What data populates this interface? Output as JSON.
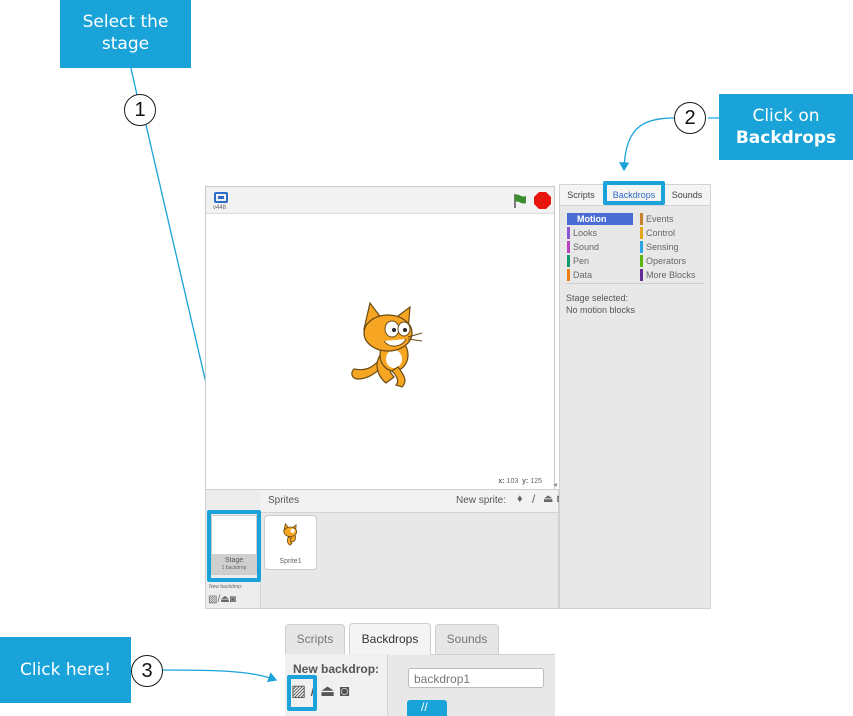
{
  "callouts": {
    "step1": {
      "number": "1",
      "lines": [
        "Select the",
        "stage"
      ]
    },
    "step2": {
      "number": "2",
      "lines": [
        "Click on",
        "Backdrops"
      ]
    },
    "step3": {
      "number": "3",
      "text": "Click here!"
    }
  },
  "stage": {
    "version": "v448",
    "coords": {
      "x_label": "x:",
      "x_value": "103",
      "y_label": "y:",
      "y_value": "125"
    }
  },
  "right_panel": {
    "tabs": [
      "Scripts",
      "Backdrops",
      "Sounds"
    ],
    "categories_left": [
      {
        "label": "Motion",
        "color": "#4a6cd4",
        "selected": true
      },
      {
        "label": "Looks",
        "color": "#8a55d7"
      },
      {
        "label": "Sound",
        "color": "#bb42c3"
      },
      {
        "label": "Pen",
        "color": "#0e9a6c"
      },
      {
        "label": "Data",
        "color": "#ee7d16"
      }
    ],
    "categories_right": [
      {
        "label": "Events",
        "color": "#c88330"
      },
      {
        "label": "Control",
        "color": "#e1a91a"
      },
      {
        "label": "Sensing",
        "color": "#2ca5e2"
      },
      {
        "label": "Operators",
        "color": "#5cb712"
      },
      {
        "label": "More Blocks",
        "color": "#632d99"
      }
    ],
    "message_line1": "Stage selected:",
    "message_line2": "No motion blocks"
  },
  "sprites_panel": {
    "title": "Sprites",
    "new_sprite_label": "New sprite:",
    "stage_thumb": {
      "name": "Stage",
      "sub": "1 backdrop"
    },
    "new_backdrop_label": "New backdrop:",
    "sprites": [
      {
        "name": "Sprite1"
      }
    ]
  },
  "zoom_panel": {
    "tabs": [
      "Scripts",
      "Backdrops",
      "Sounds"
    ],
    "new_backdrop_label": "New backdrop:",
    "backdrop_name": "backdrop1"
  },
  "colors": {
    "accent": "#1aa3d9",
    "cat_orange": "#f7a624",
    "green_flag": "#3b8f2c",
    "stop": "#e8150e"
  },
  "icons": [
    "fullscreen-icon",
    "green-flag-icon",
    "stop-icon",
    "paint-icon",
    "brush-icon",
    "upload-icon",
    "camera-icon",
    "image-library-icon"
  ]
}
